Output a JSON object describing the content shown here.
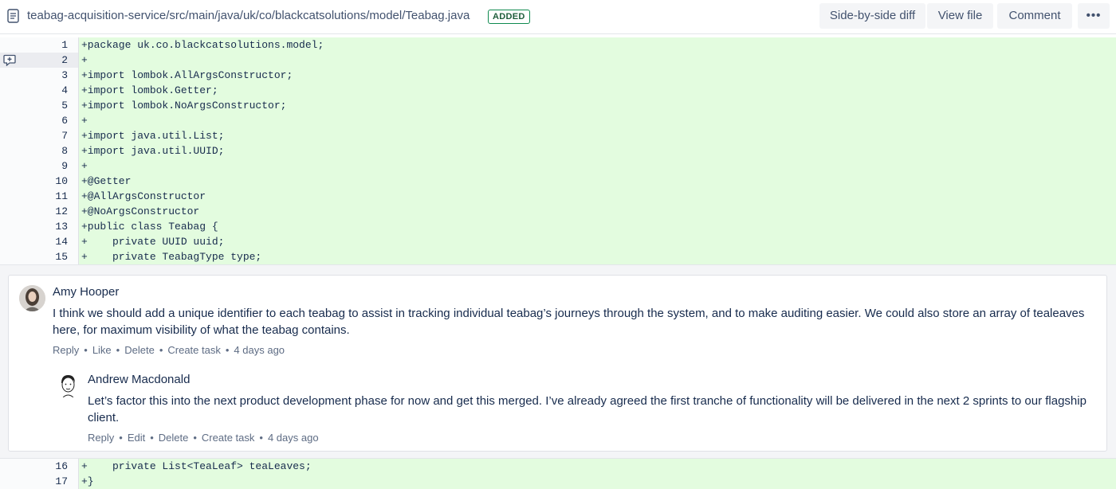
{
  "header": {
    "file_path": "teabag-acquisition-service/src/main/java/uk/co/blackcatsolutions/model/Teabag.java",
    "status_badge": "ADDED",
    "side_by_side_label": "Side-by-side diff",
    "view_file_label": "View file",
    "comment_label": "Comment",
    "more_label": "•••"
  },
  "diff_top": [
    {
      "num": "1",
      "code": "+package uk.co.blackcatsolutions.model;"
    },
    {
      "num": "2",
      "code": "+"
    },
    {
      "num": "3",
      "code": "+import lombok.AllArgsConstructor;"
    },
    {
      "num": "4",
      "code": "+import lombok.Getter;"
    },
    {
      "num": "5",
      "code": "+import lombok.NoArgsConstructor;"
    },
    {
      "num": "6",
      "code": "+"
    },
    {
      "num": "7",
      "code": "+import java.util.List;"
    },
    {
      "num": "8",
      "code": "+import java.util.UUID;"
    },
    {
      "num": "9",
      "code": "+"
    },
    {
      "num": "10",
      "code": "+@Getter"
    },
    {
      "num": "11",
      "code": "+@AllArgsConstructor"
    },
    {
      "num": "12",
      "code": "+@NoArgsConstructor"
    },
    {
      "num": "13",
      "code": "+public class Teabag {"
    },
    {
      "num": "14",
      "code": "+    private UUID uuid;"
    },
    {
      "num": "15",
      "code": "+    private TeabagType type;"
    }
  ],
  "diff_bottom": [
    {
      "num": "16",
      "code": "+    private List<TeaLeaf> teaLeaves;"
    },
    {
      "num": "17",
      "code": "+}"
    }
  ],
  "comments": {
    "first": {
      "author": "Amy Hooper",
      "text": "I think we should add a unique identifier to each teabag to assist in tracking individual teabag’s journeys through the system, and to make auditing easier. We could also store an array of tealeaves here, for maximum visibility of what the teabag contains.",
      "actions": {
        "reply": "Reply",
        "like": "Like",
        "delete": "Delete",
        "create_task": "Create task",
        "time": "4 days ago"
      }
    },
    "reply": {
      "author": "Andrew Macdonald",
      "text": "Let’s factor this into the next product development phase for now and get this merged. I’ve already agreed the first tranche of functionality will be delivered in the next 2 sprints to our flagship client.",
      "actions": {
        "reply": "Reply",
        "edit": "Edit",
        "delete": "Delete",
        "create_task": "Create task",
        "time": "4 days ago"
      }
    }
  },
  "icons": {
    "file": "file-icon",
    "add_comment": "add-comment-icon",
    "avatar_amy": "avatar-amy-hooper",
    "avatar_andrew": "avatar-andrew-macdonald"
  }
}
